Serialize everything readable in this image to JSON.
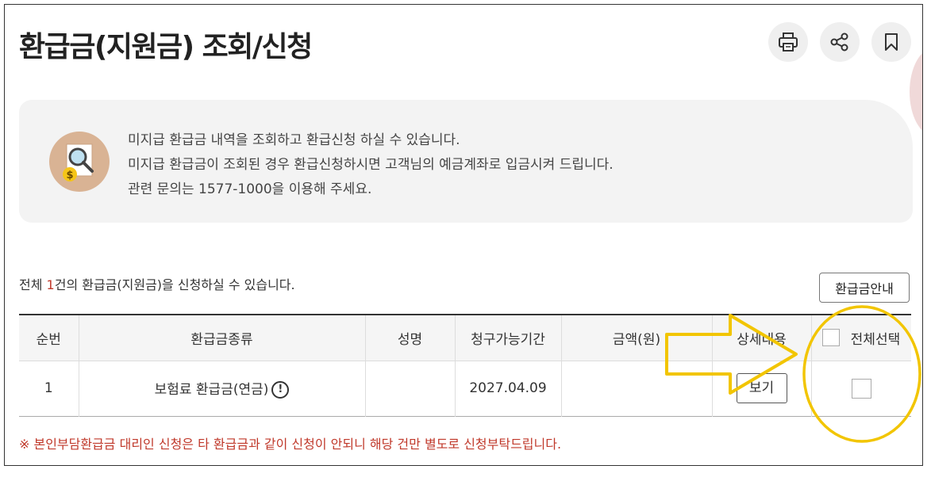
{
  "page": {
    "title": "환급금(지원금) 조회/신청",
    "tools": [
      {
        "icon": "print-icon"
      },
      {
        "icon": "share-icon"
      },
      {
        "icon": "bookmark-icon"
      }
    ]
  },
  "info": {
    "icon": "document-search-coin-icon",
    "lines": [
      "미지급 환급금 내역을 조회하고 환급신청 하실 수 있습니다.",
      "미지급 환급금이 조회된 경우 환급신청하시면 고객님의 예금계좌로 입금시켜 드립니다.",
      "관련 문의는 1577-1000을 이용해 주세요."
    ]
  },
  "summary": {
    "prefix": "전체 ",
    "count": "1",
    "suffix": "건의 환급금(지원금)을 신청하실 수 있습니다."
  },
  "guide_button": "환급금안내",
  "table": {
    "headers": {
      "index": "순번",
      "type": "환급금종류",
      "name": "성명",
      "period": "청구가능기간",
      "amount": "금액(원)",
      "detail": "상세내용",
      "select_all": "전체선택"
    },
    "rows": [
      {
        "index": "1",
        "type": "보험료 환급금(연금)",
        "name": "",
        "period": "2027.04.09",
        "amount": "",
        "detail_button": "보기",
        "checked": false
      }
    ]
  },
  "notice": "※ 본인부담환급금 대리인 신청은 타 환급금과 같이 신청이 안되니 해당 건만 별도로 신청부탁드립니다.",
  "annotations": {
    "arrow_color": "#f2c500",
    "circle_color": "#f2c500"
  }
}
